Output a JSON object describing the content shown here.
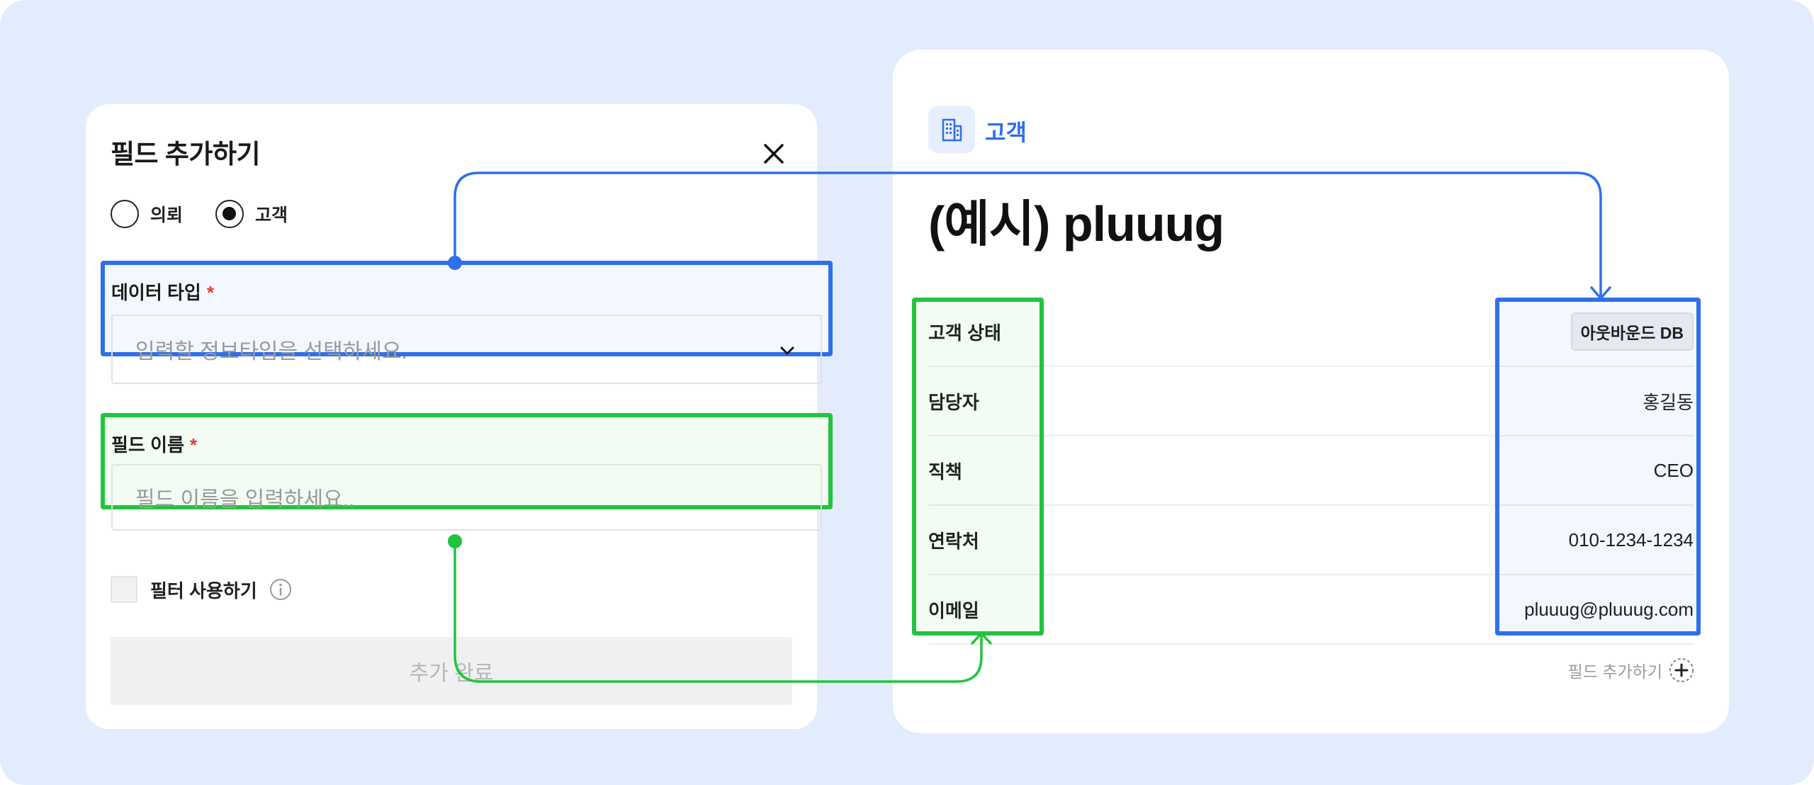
{
  "modal": {
    "title": "필드 추가하기",
    "close_icon": "close-icon",
    "radio_options": [
      {
        "label": "의뢰",
        "checked": false
      },
      {
        "label": "고객",
        "checked": true
      }
    ],
    "data_type": {
      "label": "데이터 타입",
      "required_mark": "*",
      "placeholder": "입력할 정보타입을 선택하세요.",
      "icon": "chevron-down-icon"
    },
    "field_name": {
      "label": "필드 이름",
      "required_mark": "*",
      "placeholder": "필드 이름을 입력하세요.."
    },
    "filter_checkbox": {
      "label": "필터 사용하기",
      "checked": false,
      "icon": "info-icon"
    },
    "submit_label": "추가 완료"
  },
  "card": {
    "category_icon": "building-icon",
    "category": "고객",
    "title": "(예시) pluuug",
    "rows": [
      {
        "label": "고객 상태",
        "value": "아웃바운드 DB",
        "badge": true
      },
      {
        "label": "담당자",
        "value": "홍길동"
      },
      {
        "label": "직책",
        "value": "CEO"
      },
      {
        "label": "연락처",
        "value": "010-1234-1234"
      },
      {
        "label": "이메일",
        "value": "pluuug@pluuug.com"
      }
    ],
    "add_field_label": "필드 추가하기",
    "add_field_icon": "plus-icon"
  },
  "colors": {
    "background": "#e3ecfd",
    "accent_blue": "#2f6fea",
    "accent_green": "#22c43f",
    "required": "#e53935"
  }
}
